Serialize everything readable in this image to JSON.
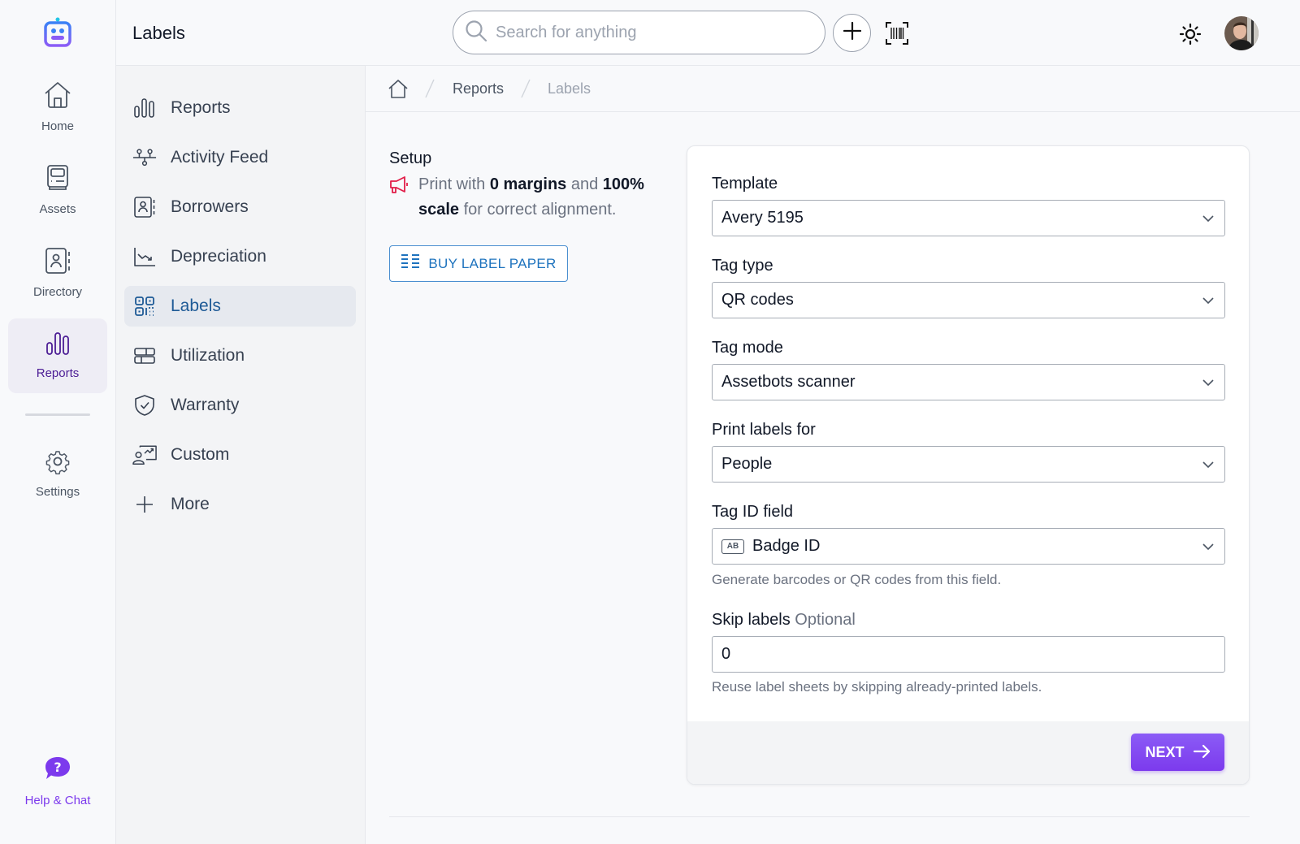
{
  "app": {
    "page_title": "Labels",
    "brand_colors": {
      "primary": "#7c3aed",
      "link": "#1e73be",
      "alert": "#e11d48"
    }
  },
  "rail": {
    "items": [
      {
        "label": "Home",
        "icon": "home-icon"
      },
      {
        "label": "Assets",
        "icon": "assets-icon"
      },
      {
        "label": "Directory",
        "icon": "directory-icon"
      },
      {
        "label": "Reports",
        "icon": "reports-icon",
        "active": true
      },
      {
        "label": "Settings",
        "icon": "gear-icon"
      }
    ],
    "help_label": "Help & Chat"
  },
  "topbar": {
    "search_placeholder": "Search for anything",
    "search_value": ""
  },
  "subnav": {
    "items": [
      {
        "label": "Reports",
        "icon": "bar-chart-icon"
      },
      {
        "label": "Activity Feed",
        "icon": "activity-icon"
      },
      {
        "label": "Borrowers",
        "icon": "contact-book-icon"
      },
      {
        "label": "Depreciation",
        "icon": "trend-down-icon"
      },
      {
        "label": "Labels",
        "icon": "qr-code-icon",
        "active": true
      },
      {
        "label": "Utilization",
        "icon": "utilization-icon"
      },
      {
        "label": "Warranty",
        "icon": "shield-check-icon"
      },
      {
        "label": "Custom",
        "icon": "custom-report-icon"
      },
      {
        "label": "More",
        "icon": "plus-icon"
      }
    ]
  },
  "breadcrumb": {
    "items": [
      "Reports",
      "Labels"
    ]
  },
  "setup": {
    "title": "Setup",
    "note_parts": [
      "Print with ",
      "0 margins",
      " and ",
      "100%",
      " ",
      "scale",
      " for correct alignment."
    ],
    "buy_button": "BUY LABEL PAPER"
  },
  "form": {
    "template": {
      "label": "Template",
      "value": "Avery 5195"
    },
    "tag_type": {
      "label": "Tag type",
      "value": "QR codes"
    },
    "tag_mode": {
      "label": "Tag mode",
      "value": "Assetbots scanner"
    },
    "print_for": {
      "label": "Print labels for",
      "value": "People"
    },
    "tag_id_field": {
      "label": "Tag ID field",
      "value": "Badge ID",
      "badge": "AB",
      "help": "Generate barcodes or QR codes from this field."
    },
    "skip_labels": {
      "label": "Skip labels",
      "optional": "Optional",
      "value": "0",
      "help": "Reuse label sheets by skipping already-printed labels."
    },
    "next_button": "NEXT"
  }
}
